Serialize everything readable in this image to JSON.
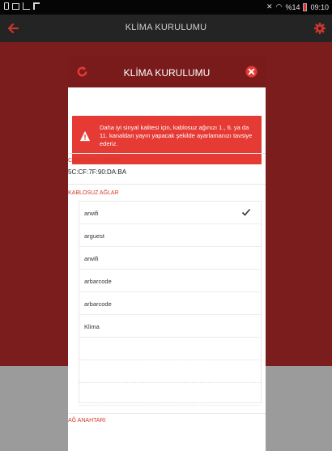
{
  "status_bar": {
    "battery": "%14",
    "time": "09:10"
  },
  "app_bar": {
    "title": "KLİMA KURULUMU"
  },
  "modal": {
    "title": "KLİMA KURULUMU",
    "alert_text": "Daha iyi sinyal kalitesi için, kablosuz ağınızı 1., 6. ya da 11. kanaldan yayın yapacak şekilde ayarlamanızı tavsiye ederiz.",
    "mac_label": "COSA MAC ADRESİ",
    "mac_value": "5C:CF:7F:90:DA:BA",
    "networks_label": "KABLOSUZ AĞLAR",
    "networks": [
      {
        "name": "arwifi",
        "selected": true
      },
      {
        "name": "arguest",
        "selected": false
      },
      {
        "name": "arwifi",
        "selected": false
      },
      {
        "name": "arbarcode",
        "selected": false
      },
      {
        "name": "arbarcode",
        "selected": false
      },
      {
        "name": "Klima",
        "selected": false
      }
    ],
    "empty_rows": 4,
    "key_label": "AĞ ANAHTARI"
  },
  "colors": {
    "accent_red": "#e63a34",
    "header_red": "#7a1b1b",
    "label_red": "#d23a2e"
  },
  "icons": [
    "back-arrow-icon",
    "gear-icon",
    "refresh-icon",
    "close-icon",
    "warning-icon",
    "check-icon"
  ]
}
